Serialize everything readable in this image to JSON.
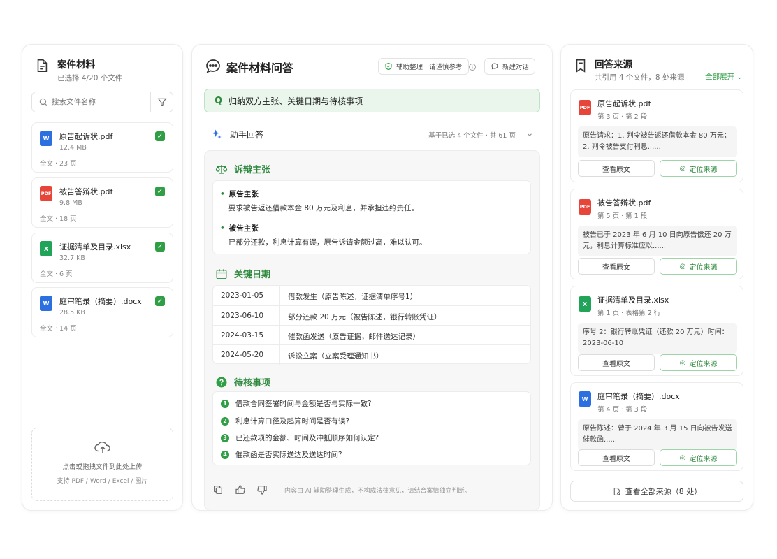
{
  "left": {
    "title": "案件材料",
    "subtitle": "已选择 4/20 个文件",
    "search_placeholder": "搜索文件名称",
    "files": [
      {
        "type": "word",
        "icon_text": "W",
        "name": "原告起诉状.pdf",
        "size": "12.4 MB",
        "meta": "全文 · 23 页"
      },
      {
        "type": "pdf",
        "icon_text": "PDF",
        "name": "被告答辩状.pdf",
        "size": "9.8 MB",
        "meta": "全文 · 18 页"
      },
      {
        "type": "excel",
        "icon_text": "X",
        "name": "证据清单及目录.xlsx",
        "size": "32.7 KB",
        "meta": "全文 · 6 页"
      },
      {
        "type": "word",
        "icon_text": "W",
        "name": "庭审笔录（摘要）.docx",
        "size": "28.5 KB",
        "meta": "全文 · 14 页"
      }
    ],
    "upload": {
      "line1": "点击或拖拽文件到此处上传",
      "line2": "支持 PDF / Word / Excel / 图片"
    }
  },
  "mid": {
    "title": "案件材料问答",
    "badge": "辅助整理 · 请谨慎参考",
    "new_chat": "新建对话",
    "question_mark": "Q",
    "question": "归纳双方主张、关键日期与待核事项",
    "assistant_label": "助手回答",
    "basis": "基于已选 4 个文件 · 共 61 页",
    "claims_title": "诉辩主张",
    "claims": [
      {
        "head": "原告主张",
        "text": "要求被告返还借款本金 80 万元及利息，并承担违约责任。"
      },
      {
        "head": "被告主张",
        "text": "已部分还款，利息计算有误，原告诉请金额过高，难以认可。"
      }
    ],
    "dates_title": "关键日期",
    "dates": [
      {
        "date": "2023-01-05",
        "event": "借款发生（原告陈述，证据清单序号1）"
      },
      {
        "date": "2023-06-10",
        "event": "部分还款 20 万元（被告陈述，银行转账凭证）"
      },
      {
        "date": "2024-03-15",
        "event": "催款函发送（原告证据，邮件送达记录）"
      },
      {
        "date": "2024-05-20",
        "event": "诉讼立案（立案受理通知书）"
      }
    ],
    "todo_title": "待核事项",
    "todos": [
      {
        "n": "1",
        "text": "借款合同签署时间与金额是否与实际一致?"
      },
      {
        "n": "2",
        "text": "利息计算口径及起算时间是否有误?"
      },
      {
        "n": "3",
        "text": "已还款项的金额、时间及冲抵顺序如何认定?"
      },
      {
        "n": "4",
        "text": "催款函是否实际送达及送达时间?"
      }
    ],
    "disclaimer": "内容由 AI 辅助整理生成，不构成法律意见，请结合案情独立判断。"
  },
  "right": {
    "title": "回答来源",
    "subtitle": "共引用 4 个文件，8 处来源",
    "expand": "全部展开",
    "sources": [
      {
        "type": "pdf",
        "icon_text": "PDF",
        "name": "原告起诉状.pdf",
        "loc": "第 3 页 · 第 2 段",
        "quote": "原告请求：1. 判令被告返还借款本金 80 万元；2. 判令被告支付利息......"
      },
      {
        "type": "pdf",
        "icon_text": "PDF",
        "name": "被告答辩状.pdf",
        "loc": "第 5 页 · 第 1 段",
        "quote": "被告已于 2023 年 6 月 10 日向原告偿还 20 万元，利息计算标准应以......"
      },
      {
        "type": "excel",
        "icon_text": "X",
        "name": "证据清单及目录.xlsx",
        "loc": "第 1 页 · 表格第 2 行",
        "quote": "序号 2：银行转账凭证（还款 20 万元）时间：2023-06-10"
      },
      {
        "type": "word",
        "icon_text": "W",
        "name": "庭审笔录（摘要）.docx",
        "loc": "第 4 页 · 第 3 段",
        "quote": "原告陈述：曾于 2024 年 3 月 15 日向被告发送催款函......"
      }
    ],
    "view_label": "查看原文",
    "locate_label": "定位来源",
    "view_all": "查看全部来源（8 处）"
  },
  "colors": {
    "accent": "#2f9e44",
    "accent_dark": "#2f8a3f",
    "question_bg": "#eaf6ec"
  }
}
